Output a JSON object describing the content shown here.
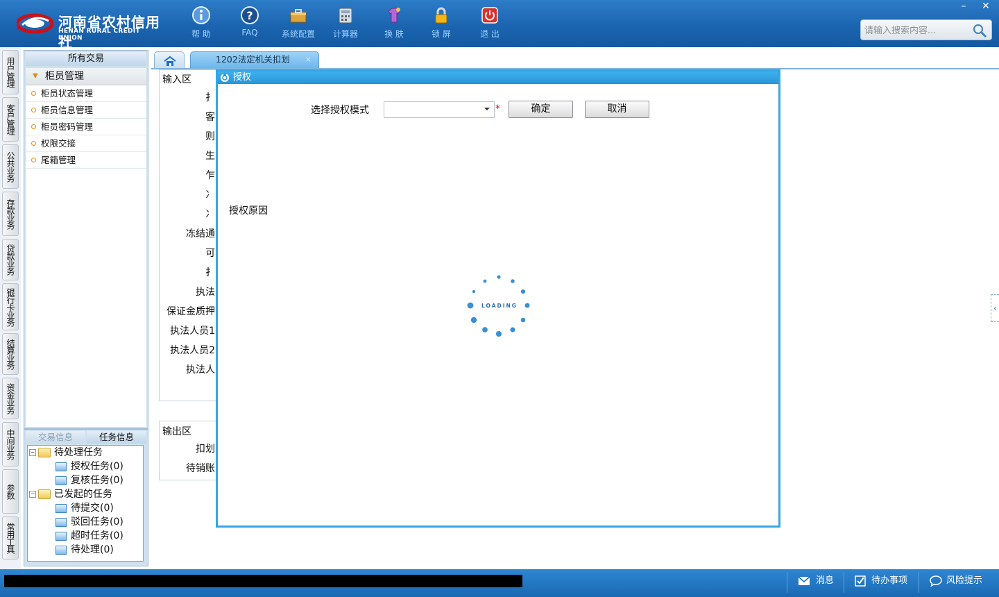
{
  "brand": {
    "name_cn": "河南省农村信用社",
    "name_en": "HENAN RURAL CREDIT UNION",
    "logo_icon": "logo-icon"
  },
  "toolbar": [
    {
      "id": "help",
      "label": "帮 助",
      "icon": "info-icon"
    },
    {
      "id": "faq",
      "label": "FAQ",
      "icon": "faq-icon"
    },
    {
      "id": "config",
      "label": "系统配置",
      "icon": "toolbox-icon"
    },
    {
      "id": "calc",
      "label": "计算器",
      "icon": "calculator-icon"
    },
    {
      "id": "skin",
      "label": "换 肤",
      "icon": "shirt-icon"
    },
    {
      "id": "lock",
      "label": "锁 屏",
      "icon": "lock-icon"
    },
    {
      "id": "exit",
      "label": "退 出",
      "icon": "power-icon"
    }
  ],
  "search": {
    "placeholder": "请输入搜索内容..."
  },
  "window_controls": {
    "minimize": "–",
    "close": "✕"
  },
  "rail_tabs": [
    "用户管理",
    "客户管理",
    "公共业务",
    "存款业务",
    "贷款业务",
    "银行卡业务",
    "结算业务",
    "资金业务",
    "中间业务",
    "参数",
    "常用工具"
  ],
  "nav": {
    "header": "所有交易",
    "group": "柜员管理",
    "items": [
      "柜员状态管理",
      "柜员信息管理",
      "柜员密码管理",
      "权限交接",
      "尾箱管理"
    ]
  },
  "task_panel": {
    "tabs": [
      "交易信息",
      "任务信息"
    ],
    "tree": {
      "pending": {
        "label": "待处理任务",
        "children": [
          "授权任务(0)",
          "复核任务(0)"
        ]
      },
      "initiated": {
        "label": "已发起的任务",
        "children": [
          "待提交(0)",
          "驳回任务(0)",
          "超时任务(0)",
          "待处理(0)"
        ]
      }
    }
  },
  "tabs": {
    "home_icon": "home-icon",
    "active": "1202法定机关扣划",
    "close": "×"
  },
  "input_section": {
    "title": "输入区",
    "labels": [
      "扌",
      "客",
      "则",
      "生",
      "乍",
      "冫",
      "冫",
      "冻结通",
      "可",
      "扌",
      "执法",
      "保证金质押",
      "执法人员1",
      "执法人员2",
      "执法人"
    ]
  },
  "output_section": {
    "title": "输出区",
    "labels": [
      "扣划",
      "待销账"
    ]
  },
  "dialog": {
    "title": "授权",
    "mode_label": "选择授权模式",
    "mode_value": "",
    "required_mark": "*",
    "confirm": "确定",
    "cancel": "取消",
    "reason_label": "授权原因",
    "loading_text": "LOADING"
  },
  "collapse": "‹",
  "statusbar": {
    "items": [
      {
        "label": "消息",
        "icon": "mail-icon"
      },
      {
        "label": "待办事项",
        "icon": "checkbox-icon"
      },
      {
        "label": "风险提示",
        "icon": "chat-icon"
      }
    ]
  },
  "colors": {
    "header": "#1a63ae",
    "dialog_border": "#36a5e3",
    "accent_orange": "#e28b1f",
    "statusbar": "#1969b5"
  }
}
